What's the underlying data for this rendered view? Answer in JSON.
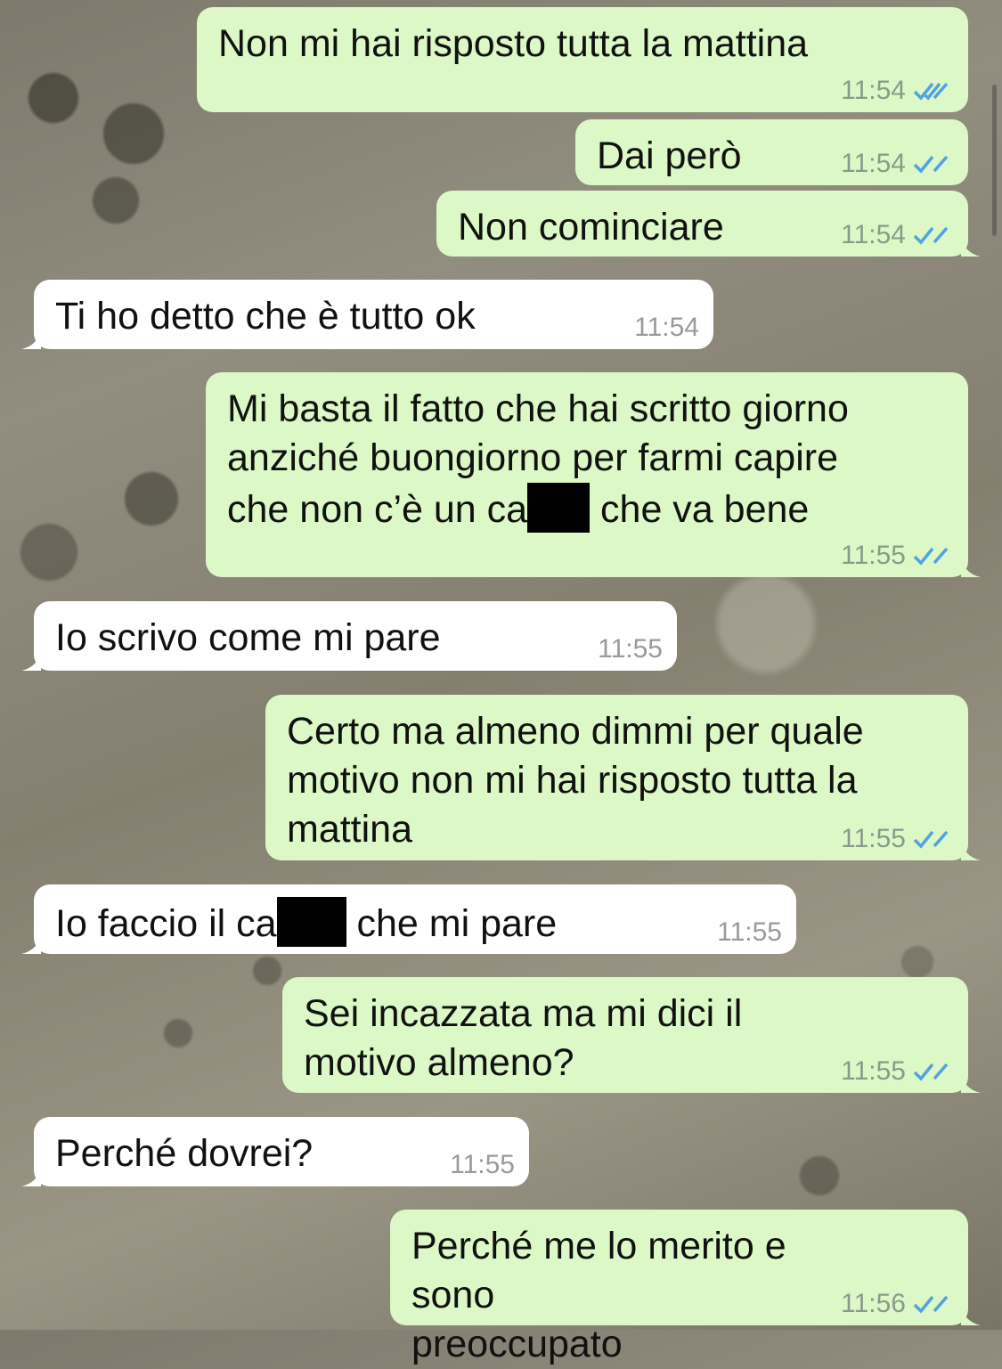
{
  "colors": {
    "outgoing_bubble": "#dcf8c6",
    "incoming_bubble": "#ffffff",
    "read_ticks": "#4fa3e0"
  },
  "messages": [
    {
      "dir": "out",
      "text": "Non mi hai risposto tutta la mattina",
      "time": "11:54",
      "status_icon": "double-check-read-icon"
    },
    {
      "dir": "out",
      "text": "Dai però",
      "time": "11:54",
      "status_icon": "double-check-read-icon"
    },
    {
      "dir": "out",
      "text": "Non cominciare",
      "time": "11:54",
      "status_icon": "double-check-read-icon"
    },
    {
      "dir": "in",
      "text": "Ti ho detto che è tutto ok",
      "time": "11:54"
    },
    {
      "dir": "out",
      "text_parts": [
        "Mi basta il fatto che hai scritto giorno\nanziché buongiorno per farmi capire\nche non c’è un ca",
        " che va bene"
      ],
      "time": "11:55",
      "status_icon": "double-check-read-icon"
    },
    {
      "dir": "in",
      "text": "Io scrivo come mi pare",
      "time": "11:55"
    },
    {
      "dir": "out",
      "text": "Certo ma almeno dimmi per quale\nmotivo non mi hai risposto tutta la\nmattina",
      "time": "11:55",
      "status_icon": "double-check-read-icon"
    },
    {
      "dir": "in",
      "text_parts": [
        "Io faccio il ca",
        " che mi pare"
      ],
      "time": "11:55"
    },
    {
      "dir": "out",
      "text": "Sei incazzata ma mi dici il\nmotivo almeno?",
      "time": "11:55",
      "status_icon": "double-check-read-icon"
    },
    {
      "dir": "in",
      "text": "Perché dovrei?",
      "time": "11:55"
    },
    {
      "dir": "out",
      "text": "Perché me lo merito e sono\npreoccupato",
      "time": "11:56",
      "status_icon": "double-check-read-icon"
    }
  ]
}
